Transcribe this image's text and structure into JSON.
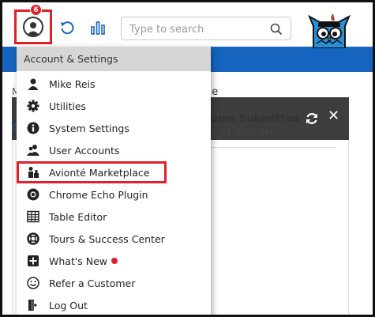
{
  "topbar": {
    "notification_count": "6",
    "search_placeholder": "Type to search"
  },
  "panel": {
    "column_header_fragment": "age",
    "row_title_fragment": "sume Submitted",
    "row_date_fragment": "17/21 3:45 PM",
    "left_fragment_m": "M",
    "left_fragment_g": "G"
  },
  "menu": {
    "header": "Account & Settings",
    "items": [
      {
        "label": "Mike Reis",
        "icon": "user-icon"
      },
      {
        "label": "Utilities",
        "icon": "gear-icon"
      },
      {
        "label": "System Settings",
        "icon": "info-icon"
      },
      {
        "label": "User Accounts",
        "icon": "users-icon"
      },
      {
        "label": "Avionté Marketplace",
        "icon": "marketplace-icon"
      },
      {
        "label": "Chrome Echo Plugin",
        "icon": "chrome-icon"
      },
      {
        "label": "Table Editor",
        "icon": "table-icon"
      },
      {
        "label": "Tours & Success Center",
        "icon": "lifebuoy-icon"
      },
      {
        "label": "What's New",
        "icon": "plus-square-icon"
      },
      {
        "label": "Refer a Customer",
        "icon": "smile-icon"
      },
      {
        "label": "Log Out",
        "icon": "logout-icon"
      }
    ]
  },
  "colors": {
    "highlight_red": "#e0202a",
    "brand_blue": "#1565c0",
    "panel_dark": "#3d3d3d",
    "menu_header_gray": "#d6d6d6"
  }
}
